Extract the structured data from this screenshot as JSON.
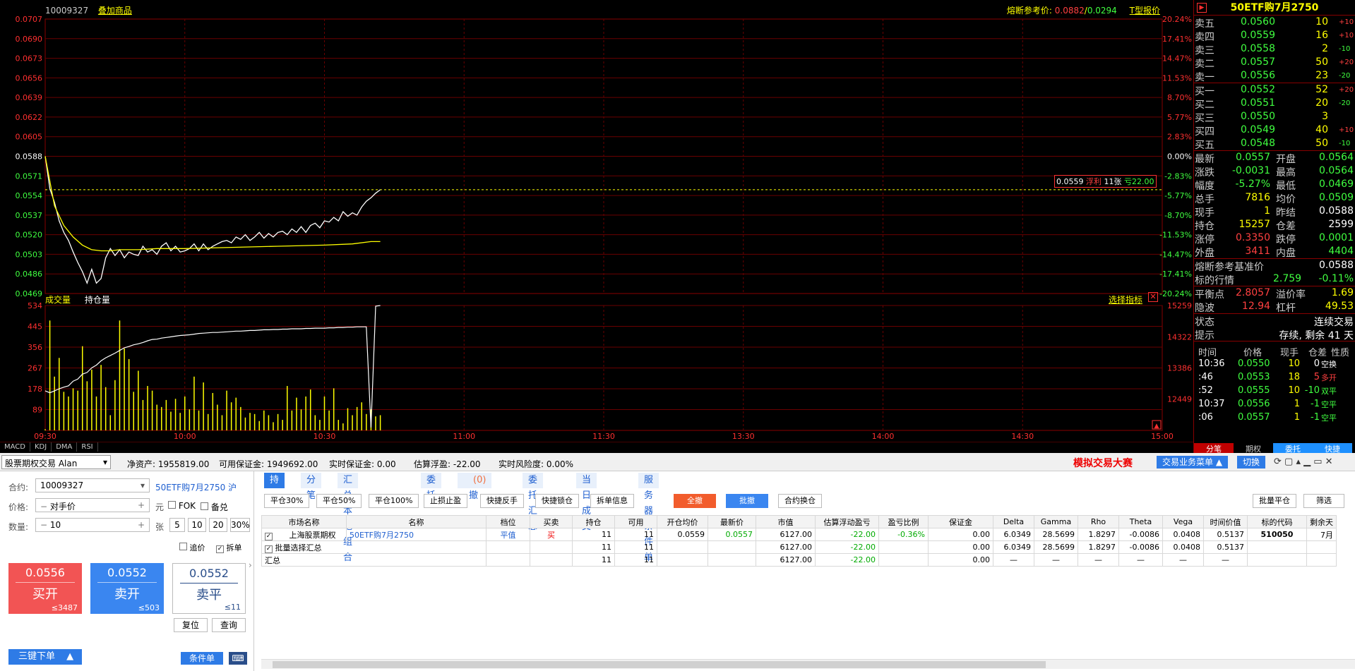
{
  "header": {
    "code": "10009327",
    "add_label": "叠加商品",
    "fuse_label": "熔断参考价:",
    "fuse_v1": "0.0882",
    "fuse_sep": "/",
    "fuse_v2": "0.0294",
    "t_label": "T型报价"
  },
  "chart_data": [
    {
      "type": "line",
      "title": "",
      "xlabel": "",
      "ylabel": "",
      "x_ticks": [
        "09:30",
        "10:00",
        "10:30",
        "11:00",
        "11:30",
        "13:30",
        "14:00",
        "14:30",
        "15:00"
      ],
      "y_ticks": [
        "0.0707",
        "0.0690",
        "0.0673",
        "0.0656",
        "0.0639",
        "0.0622",
        "0.0605",
        "0.0588",
        "0.0571",
        "0.0554",
        "0.0537",
        "0.0520",
        "0.0503",
        "0.0486",
        "0.0469"
      ],
      "y_right_ticks": [
        "20.24%",
        "17.41%",
        "14.47%",
        "11.53%",
        "8.70%",
        "5.77%",
        "2.83%",
        "0.00%",
        "-2.83%",
        "-5.77%",
        "-8.70%",
        "-11.53%",
        "-14.47%",
        "-17.41%",
        "-20.24%"
      ],
      "ylim": [
        0.0469,
        0.0707
      ],
      "series": [
        {
          "name": "",
          "color": "#ffffff",
          "x": [
            0,
            1,
            2,
            3,
            4,
            5,
            6,
            7,
            8,
            9,
            10,
            11,
            12,
            13,
            14,
            15,
            16,
            17,
            18,
            19,
            20,
            21,
            22,
            23,
            24,
            25,
            26,
            27,
            28,
            29,
            30,
            31,
            32,
            33,
            34,
            35,
            36,
            37,
            38,
            39,
            40,
            41,
            42,
            43,
            44,
            45,
            46,
            47,
            48,
            49,
            50,
            51,
            52,
            53,
            54,
            55,
            56,
            57,
            58,
            59,
            60,
            61,
            62,
            63,
            64,
            65,
            66,
            67,
            68,
            69,
            70,
            71,
            72
          ],
          "y": [
            0.0588,
            0.056,
            0.0548,
            0.0532,
            0.0522,
            0.0515,
            0.0505,
            0.0496,
            0.0488,
            0.0478,
            0.049,
            0.0478,
            0.0482,
            0.05,
            0.0508,
            0.0502,
            0.0507,
            0.05,
            0.0505,
            0.0503,
            0.0502,
            0.051,
            0.0505,
            0.0507,
            0.0503,
            0.051,
            0.0513,
            0.0506,
            0.051,
            0.0505,
            0.0506,
            0.0508,
            0.0512,
            0.0506,
            0.0512,
            0.0507,
            0.051,
            0.0512,
            0.0514,
            0.0515,
            0.0513,
            0.0518,
            0.0516,
            0.052,
            0.0515,
            0.0518,
            0.0522,
            0.0517,
            0.0521,
            0.0518,
            0.0522,
            0.0523,
            0.052,
            0.0525,
            0.0522,
            0.0527,
            0.0522,
            0.0528,
            0.053,
            0.0526,
            0.0532,
            0.0531,
            0.0535,
            0.0532,
            0.054,
            0.0536,
            0.0539,
            0.0537,
            0.0544,
            0.0549,
            0.0552,
            0.0556,
            0.0559
          ]
        },
        {
          "name": "",
          "color": "#ffff00",
          "x": [
            0,
            2,
            4,
            6,
            8,
            10,
            12,
            14,
            16,
            20,
            24,
            30,
            40,
            50,
            60,
            66,
            70,
            72
          ],
          "y": [
            0.0588,
            0.0545,
            0.0528,
            0.0518,
            0.0511,
            0.0507,
            0.0506,
            0.0506,
            0.0507,
            0.0507,
            0.0508,
            0.0508,
            0.0509,
            0.051,
            0.0511,
            0.0512,
            0.0514,
            0.0514
          ]
        }
      ],
      "ref_line": 0.0559
    },
    {
      "type": "bar",
      "title": "",
      "xlabel": "",
      "ylabel": "",
      "y_ticks": [
        "534",
        "445",
        "356",
        "267",
        "178",
        "89"
      ],
      "y_right_ticks": [
        "15259",
        "14322",
        "13386",
        "12449"
      ],
      "ylim": [
        0,
        534
      ],
      "oi_range": [
        11512,
        15259
      ],
      "values": [
        5,
        470,
        230,
        310,
        165,
        145,
        180,
        170,
        360,
        210,
        260,
        145,
        280,
        185,
        65,
        215,
        470,
        350,
        305,
        165,
        255,
        130,
        190,
        170,
        110,
        100,
        130,
        80,
        135,
        75,
        145,
        90,
        230,
        85,
        205,
        70,
        160,
        110,
        65,
        170,
        120,
        140,
        100,
        55,
        75,
        70,
        40,
        85,
        65,
        35,
        70,
        45,
        190,
        85,
        140,
        90,
        145,
        175,
        65,
        45,
        145,
        85,
        180,
        45,
        30,
        95,
        65,
        100,
        120,
        70,
        90,
        60,
        65
      ],
      "oi": [
        12700,
        12640,
        12700,
        12760,
        12810,
        12850,
        12990,
        13050,
        13200,
        13250,
        13390,
        13470,
        13600,
        13690,
        13760,
        13830,
        13910,
        13990,
        14030,
        14080,
        14110,
        14150,
        14200,
        14240,
        14250,
        14280,
        14300,
        14320,
        14340,
        14360,
        14370,
        14380,
        14400,
        14420,
        14430,
        14440,
        14450,
        14450,
        14460,
        14470,
        14480,
        14490,
        14490,
        14500,
        14510,
        14510,
        14520,
        14530,
        14530,
        14540,
        14540,
        14550,
        14550,
        14560,
        14560,
        14560,
        14570,
        14570,
        14580,
        14580,
        14580,
        14590,
        14590,
        14600,
        14600,
        14610,
        14610,
        14620,
        14620,
        14620,
        11600,
        15240,
        15259
      ]
    }
  ],
  "volume_labels": {
    "vol": "成交量",
    "oi": "持仓量",
    "select": "选择指标"
  },
  "price_tag": {
    "price": "0.0559",
    "fu": "浮利",
    "num": "11张",
    "loss": "亏22.00"
  },
  "indicator_tabs": [
    "MACD",
    "KDJ",
    "DMA",
    "RSI"
  ],
  "quote": {
    "title": "50ETF购7月2750",
    "sells": [
      {
        "label": "卖五",
        "price": "0.0560",
        "vol": "10",
        "chg": "+10"
      },
      {
        "label": "卖四",
        "price": "0.0559",
        "vol": "16",
        "chg": "+10"
      },
      {
        "label": "卖三",
        "price": "0.0558",
        "vol": "2",
        "chg": "-10"
      },
      {
        "label": "卖二",
        "price": "0.0557",
        "vol": "50",
        "chg": "+20"
      },
      {
        "label": "卖一",
        "price": "0.0556",
        "vol": "23",
        "chg": "-20"
      }
    ],
    "buys": [
      {
        "label": "买一",
        "price": "0.0552",
        "vol": "52",
        "chg": "+20"
      },
      {
        "label": "买二",
        "price": "0.0551",
        "vol": "20",
        "chg": "-20"
      },
      {
        "label": "买三",
        "price": "0.0550",
        "vol": "3",
        "chg": ""
      },
      {
        "label": "买四",
        "price": "0.0549",
        "vol": "40",
        "chg": "+10"
      },
      {
        "label": "买五",
        "price": "0.0548",
        "vol": "50",
        "chg": "-10"
      }
    ],
    "stats": [
      {
        "l1": "最新",
        "v1": "0.0557",
        "c1": "g",
        "l2": "开盘",
        "v2": "0.0564",
        "c2": "g"
      },
      {
        "l1": "涨跌",
        "v1": "-0.0031",
        "c1": "g",
        "l2": "最高",
        "v2": "0.0564",
        "c2": "g"
      },
      {
        "l1": "幅度",
        "v1": "-5.27%",
        "c1": "g",
        "l2": "最低",
        "v2": "0.0469",
        "c2": "g"
      },
      {
        "l1": "总手",
        "v1": "7816",
        "c1": "y",
        "l2": "均价",
        "v2": "0.0509",
        "c2": "g"
      },
      {
        "l1": "现手",
        "v1": "1",
        "c1": "y",
        "l2": "昨结",
        "v2": "0.0588",
        "c2": "w"
      },
      {
        "l1": "持仓",
        "v1": "15257",
        "c1": "y",
        "l2": "仓差",
        "v2": "2599",
        "c2": "w"
      },
      {
        "l1": "涨停",
        "v1": "0.3350",
        "c1": "r",
        "l2": "跌停",
        "v2": "0.0001",
        "c2": "g"
      },
      {
        "l1": "外盘",
        "v1": "3411",
        "c1": "r",
        "l2": "内盘",
        "v2": "4404",
        "c2": "g"
      }
    ],
    "fuse_label": "熔断参考基准价",
    "fuse_value": "0.0588",
    "underlying_label": "标的行情",
    "underlying_price": "2.759",
    "underlying_chg": "-0.11%",
    "be_label": "平衡点",
    "be_value": "2.8057",
    "premium_label": "溢价率",
    "premium_value": "1.69",
    "iv_label": "隐波",
    "iv_value": "12.94",
    "lev_label": "杠杆",
    "lev_value": "49.53",
    "state_label": "状态",
    "state_value": "连续交易",
    "tip_label": "提示",
    "tip_value": "存续, 剩余 41 天",
    "ticks_header": [
      "时间",
      "价格",
      "现手",
      "仓差",
      "性质"
    ],
    "ticks": [
      {
        "time": "10:36",
        "price": "0.0550",
        "vol": "10",
        "oi": "0",
        "type": "空换",
        "tc": "w"
      },
      {
        "time": ":46",
        "price": "0.0553",
        "vol": "18",
        "oi": "5",
        "type": "多开",
        "tc": "r"
      },
      {
        "time": ":52",
        "price": "0.0555",
        "vol": "10",
        "oi": "-10",
        "type": "双平",
        "tc": "g"
      },
      {
        "time": "10:37",
        "price": "0.0556",
        "vol": "1",
        "oi": "-1",
        "type": "空平",
        "tc": "g"
      },
      {
        "time": ":06",
        "price": "0.0557",
        "vol": "1",
        "oi": "-1",
        "type": "空平",
        "tc": "g"
      }
    ],
    "tabs": [
      "分笔",
      "期权",
      "委托",
      "快捷"
    ]
  },
  "account": {
    "type": "股票期权交易 Alan",
    "net_label": "净资产:",
    "net_value": "1955819.00",
    "avail_label": "可用保证金:",
    "avail_value": "1949692.00",
    "rt_label": "实时保证金:",
    "rt_value": "0.00",
    "float_label": "估算浮盈:",
    "float_value": "-22.00",
    "risk_label": "实时风险度:",
    "risk_value": "0.00%",
    "contest": "模拟交易大赛",
    "menu": "交易业务菜单",
    "switch": "切换"
  },
  "order": {
    "contract_label": "合约:",
    "contract_value": "10009327",
    "contract_name": "50ETF购7月2750",
    "market": "沪",
    "price_label": "价格:",
    "price_value": "对手价",
    "unit_yuan": "元",
    "fok": "FOK",
    "beidui": "备兑",
    "qty_label": "数量:",
    "qty_value": "10",
    "unit_zhang": "张",
    "qty_opts": [
      "5",
      "10",
      "20",
      "30%"
    ],
    "chase": "追价",
    "split": "拆单",
    "buy_open": {
      "price": "0.0556",
      "label": "买开",
      "qty": "≤3487"
    },
    "sell_open": {
      "price": "0.0552",
      "label": "卖开",
      "qty": "≤503"
    },
    "sell_close": {
      "price": "0.0552",
      "label": "卖平",
      "qty": "≤11"
    },
    "reset": "复位",
    "query": "查询",
    "three_key": "三键下单",
    "cond": "条件单"
  },
  "positions": {
    "tabs": [
      "持仓",
      "分笔",
      "汇总本地组合",
      "委托",
      "可撤",
      "委托汇总",
      "当日成交",
      "服务器条件单"
    ],
    "cancel_count": "(0)",
    "toolbar": [
      "平仓30%",
      "平仓50%",
      "平仓100%",
      "止损止盈",
      "快捷反手",
      "快捷锁仓",
      "拆单信息"
    ],
    "btn_all": "全撤",
    "btn_batch": "批撤",
    "btn_swap": "合约换仓",
    "btn_batch_close": "批量平仓",
    "btn_filter": "筛选",
    "columns": [
      "市场名称",
      "名称",
      "档位",
      "买卖",
      "持仓",
      "可用",
      "开仓均价",
      "最新价",
      "市值",
      "估算浮动盈亏",
      "盈亏比例",
      "保证金",
      "Delta",
      "Gamma",
      "Rho",
      "Theta",
      "Vega",
      "时间价值",
      "标的代码",
      "剩余天"
    ],
    "row": {
      "market": "上海股票期权",
      "name": "50ETF购7月2750",
      "level": "平值",
      "side": "买",
      "pos": "11",
      "avail": "11",
      "avg": "0.0559",
      "last": "0.0557",
      "mv": "6127.00",
      "pnl": "-22.00",
      "pct": "-0.36%",
      "margin": "0.00",
      "delta": "6.0349",
      "gamma": "28.5699",
      "rho": "1.8297",
      "theta": "-0.0086",
      "vega": "0.0408",
      "tv": "0.5137",
      "code": "510050",
      "days": "7月"
    },
    "batch": {
      "label": "批量选择汇总",
      "pos": "11",
      "avail": "11",
      "mv": "6127.00",
      "pnl": "-22.00",
      "margin": "0.00",
      "delta": "6.0349",
      "gamma": "28.5699",
      "rho": "1.8297",
      "theta": "-0.0086",
      "vega": "0.0408",
      "tv": "0.5137"
    },
    "total": {
      "label": "汇总",
      "pos": "11",
      "avail": "11",
      "mv": "6127.00",
      "pnl": "-22.00",
      "margin": "0.00",
      "dash": "—"
    }
  }
}
